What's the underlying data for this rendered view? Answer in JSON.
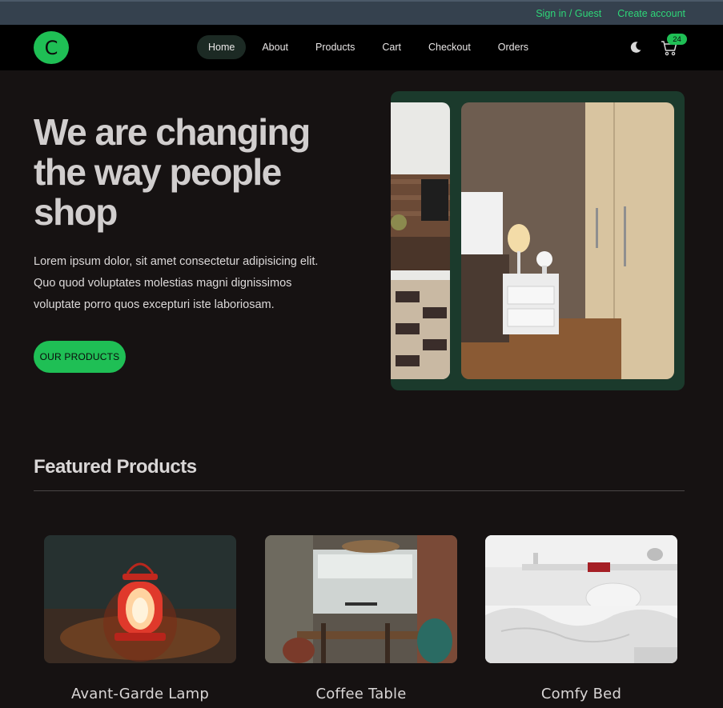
{
  "topbar": {
    "sign_in": "Sign in / Guest",
    "create_account": "Create account"
  },
  "navbar": {
    "logo_letter": "C",
    "menu": [
      {
        "label": "Home",
        "active": true
      },
      {
        "label": "About"
      },
      {
        "label": "Products"
      },
      {
        "label": "Cart"
      },
      {
        "label": "Checkout"
      },
      {
        "label": "Orders"
      }
    ],
    "theme_icon": "moon-icon",
    "cart_icon": "cart-icon",
    "cart_count": "24"
  },
  "hero": {
    "title": "We are changing the way people shop",
    "text": "Lorem ipsum dolor, sit amet consectetur adipisicing elit. Quo quod voluptates molestias magni dignissimos voluptate porro quos excepturi iste laboriosam.",
    "button": "OUR PRODUCTS"
  },
  "featured": {
    "title": "Featured Products",
    "products": [
      {
        "name": "Avant-Garde Lamp"
      },
      {
        "name": "Coffee Table"
      },
      {
        "name": "Comfy Bed"
      }
    ]
  },
  "colors": {
    "accent": "#1fbf55",
    "link": "#2ed678",
    "background": "#161212",
    "carousel": "#1b3a2c"
  }
}
